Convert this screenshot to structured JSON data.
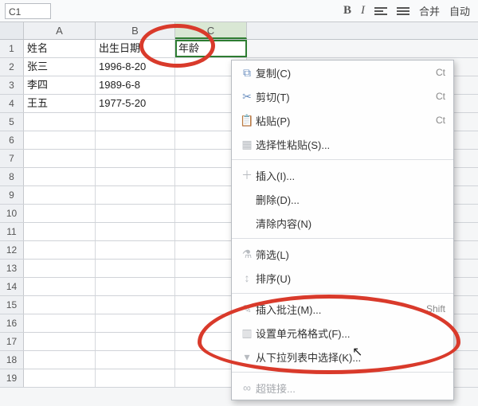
{
  "namebox": "C1",
  "toolbar": {
    "bold": "B",
    "italic": "I",
    "merge": "合并",
    "auto": "自动"
  },
  "columns": {
    "A": "A",
    "B": "B",
    "C": "C"
  },
  "rows": [
    "1",
    "2",
    "3",
    "4",
    "5",
    "6",
    "7",
    "8",
    "9",
    "10",
    "11",
    "12",
    "13",
    "14",
    "15",
    "16",
    "17",
    "18",
    "19"
  ],
  "grid": {
    "A1": "姓名",
    "B1": "出生日期",
    "C1": "年龄",
    "A2": "张三",
    "B2": "1996-8-20",
    "A3": "李四",
    "B3": "1989-6-8",
    "A4": "王五",
    "B4": "1977-5-20"
  },
  "context_menu": {
    "copy": "复制(C)",
    "cut": "剪切(T)",
    "paste": "粘贴(P)",
    "paste_special": "选择性粘贴(S)...",
    "insert": "插入(I)...",
    "delete": "删除(D)...",
    "clear": "清除内容(N)",
    "filter": "筛选(L)",
    "sort": "排序(U)",
    "insert_note": "插入批注(M)...",
    "format_cells": "设置单元格格式(F)...",
    "pick_list": "从下拉列表中选择(K)...",
    "hyperlink": "超链接...",
    "sc_copy": "Ct",
    "sc_cut": "Ct",
    "sc_paste": "Ct",
    "sc_note": "Shift"
  }
}
